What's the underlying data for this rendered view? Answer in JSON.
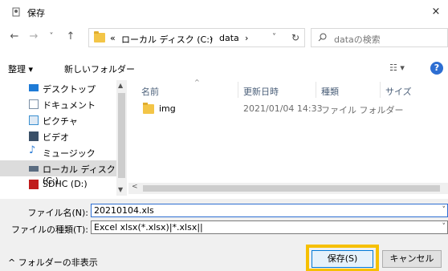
{
  "window": {
    "title": "保存",
    "close_label": "×"
  },
  "nav_buttons": {
    "back": "←",
    "forward": "→",
    "recent": "˅",
    "up": "↑"
  },
  "address": {
    "crumbs": [
      "«",
      "ローカル ディスク (C:)",
      "›",
      "data",
      "›"
    ],
    "dropdown": "˅",
    "refresh": "↻"
  },
  "search": {
    "placeholder": "dataの検索"
  },
  "toolbar": {
    "organize": "整理 ▾",
    "new_folder": "新しいフォルダー",
    "view": "☷ ▾",
    "help": "?"
  },
  "navpane": {
    "items": [
      {
        "label": "デスクトップ",
        "icon": "desktop-icon",
        "color": "#1e7bd6"
      },
      {
        "label": "ドキュメント",
        "icon": "documents-icon",
        "color": "#7a8fa6"
      },
      {
        "label": "ピクチャ",
        "icon": "pictures-icon",
        "color": "#3a8fd0"
      },
      {
        "label": "ビデオ",
        "icon": "videos-icon",
        "color": "#3a5068"
      },
      {
        "label": "ミュージック",
        "icon": "music-icon",
        "color": "#2a7bd6"
      },
      {
        "label": "ローカル ディスク (C:)",
        "icon": "drive-icon",
        "color": "#5a6c80",
        "selected": true
      },
      {
        "label": "SDHC (D:)",
        "icon": "sd-card-icon",
        "color": "#c01c1c"
      }
    ]
  },
  "filelist": {
    "columns": [
      "名前",
      "更新日時",
      "種類",
      "サイズ"
    ],
    "rows": [
      {
        "name": "img",
        "date": "2021/01/04 14:33",
        "type": "ファイル フォルダー",
        "size": ""
      }
    ]
  },
  "form": {
    "filename_label": "ファイル名(N):",
    "filename_value": "20210104.xls",
    "filetype_label": "ファイルの種類(T):",
    "filetype_value": "Excel xlsx(*.xlsx)|*.xlsx||",
    "hide_folders": "^ フォルダーの非表示",
    "save_label": "保存(S)",
    "cancel_label": "キャンセル"
  },
  "colors": {
    "accent": "#0078d7",
    "highlight": "#f6c000",
    "folder": "#f3c547"
  }
}
